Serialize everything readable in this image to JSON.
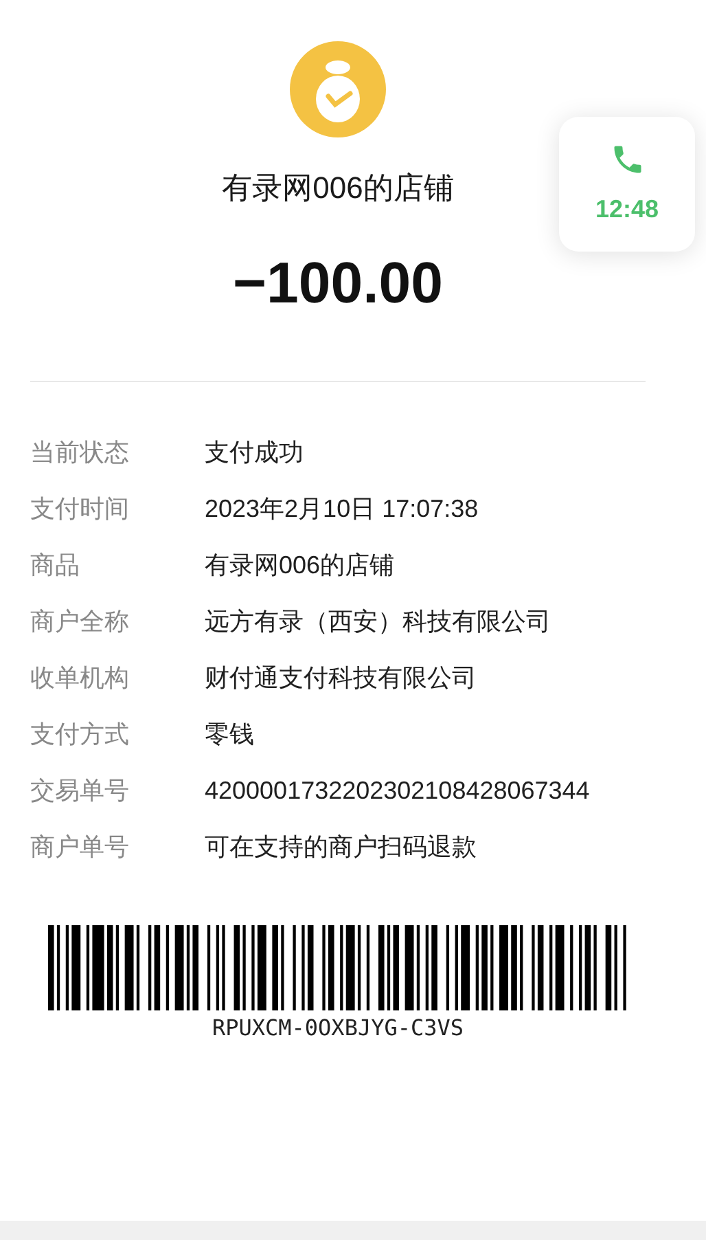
{
  "merchant": {
    "name": "有录网006的店铺"
  },
  "amount": "−100.00",
  "details": [
    {
      "label": "当前状态",
      "value": "支付成功"
    },
    {
      "label": "支付时间",
      "value": "2023年2月10日 17:07:38"
    },
    {
      "label": "商品",
      "value": "有录网006的店铺"
    },
    {
      "label": "商户全称",
      "value": "远方有录（西安）科技有限公司"
    },
    {
      "label": "收单机构",
      "value": "财付通支付科技有限公司"
    },
    {
      "label": "支付方式",
      "value": "零钱"
    },
    {
      "label": "交易单号",
      "value": "4200001732202302108428067344"
    },
    {
      "label": "商户单号",
      "value": "可在支持的商户扫码退款"
    }
  ],
  "barcode": {
    "code": "RPUXCM-0OXBJYG-C3VS"
  },
  "call_widget": {
    "time": "12:48"
  }
}
